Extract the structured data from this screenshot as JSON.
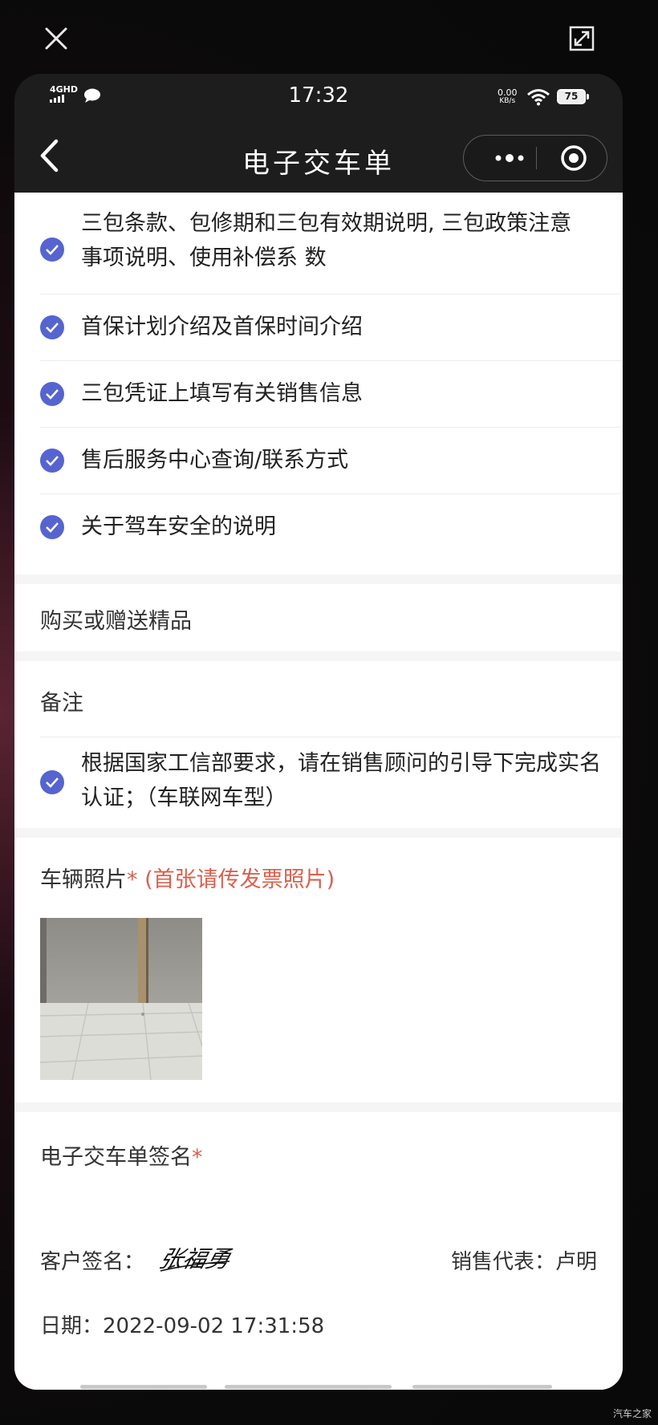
{
  "status_bar": {
    "network": "4GHD",
    "time": "17:32",
    "speed_value": "0.00",
    "speed_unit": "KB/s",
    "battery": "75"
  },
  "nav": {
    "title": "电子交车单"
  },
  "checklist": [
    "三包条款、包修期和三包有效期说明, 三包政策注意事项说明、使用补偿系 数",
    "首保计划介绍及首保时间介绍",
    "三包凭证上填写有关销售信息",
    "售后服务中心查询/联系方式",
    "关于驾车安全的说明"
  ],
  "gifts": {
    "label": "购买或赠送精品"
  },
  "remarks": {
    "label": "备注",
    "item": "根据国家工信部要求，请在销售顾问的引导下完成实名认证；（车联网车型）"
  },
  "vehicle_photos": {
    "label": "车辆照片",
    "required_mark": "*",
    "hint": "(首张请传发票照片)"
  },
  "signature": {
    "label": "电子交车单签名",
    "required_mark": "*",
    "customer_label": "客户签名：",
    "customer_signature_text": "张福勇",
    "sales_label": "销售代表：",
    "sales_name": "卢明",
    "date_label": "日期：",
    "date_value": "2022-09-02 17:31:58"
  },
  "watermark": "汽车之家",
  "colors": {
    "check_blue": "#5664cf",
    "required_red": "#d9604e",
    "nav_bg": "#1d1d1e"
  }
}
